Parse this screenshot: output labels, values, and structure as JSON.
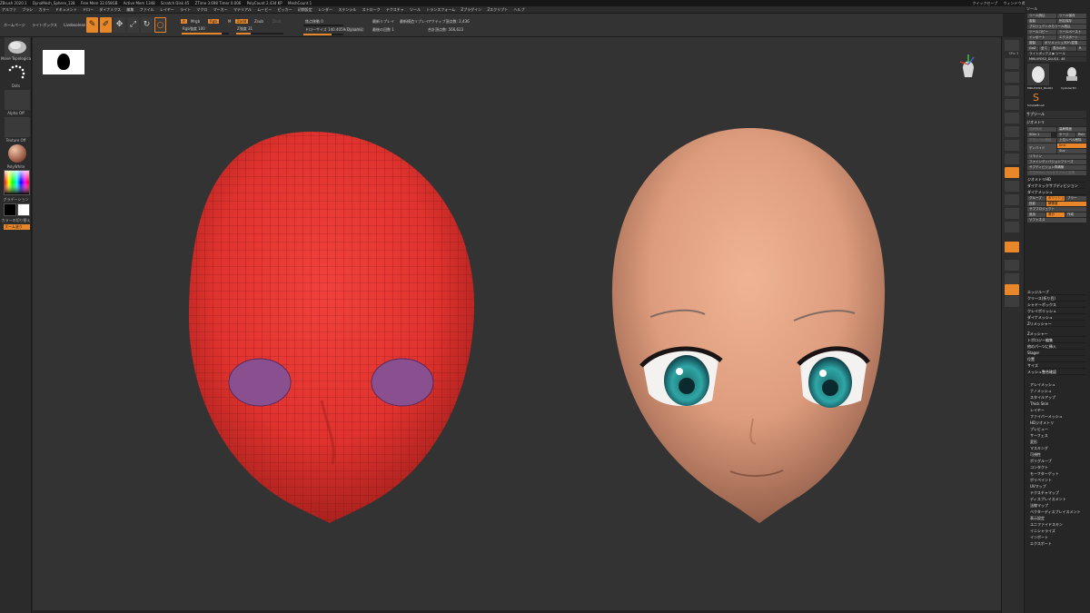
{
  "titlebar": {
    "title": "ZBrush 2020.1",
    "doc": "DynaMesh_Sphere_128",
    "stats": [
      "Free Mem 32.058GB",
      "Active Mem 1348",
      "Scratch Disk 45",
      "ZTime 3.698 Timer 0.006",
      "PolyCount 2.434 KP",
      "MeshCount 1"
    ],
    "right": [
      "クイックセーブ",
      "ウィンドウ透明度",
      "Menu",
      "DefaultZScript"
    ]
  },
  "menubar": {
    "items": [
      "アルファ",
      "ブラシ",
      "カラー",
      "ドキュメント",
      "ドロー",
      "ダイナミクス",
      "編集",
      "ファイル",
      "レイヤー",
      "ライト",
      "マクロ",
      "マーカー",
      "マテリアル",
      "ムービー",
      "ピッカー",
      "初期設定",
      "レンダー",
      "ステンシル",
      "ストローク",
      "テクスチャ",
      "ツール",
      "トランスフォーム",
      "Zプラグイン",
      "Zスクリプト",
      "ヘルプ"
    ]
  },
  "shelf": {
    "nav": [
      "ホームページ",
      "ライトボックス",
      "Liveboolean"
    ],
    "tool_buttons": [
      "編集",
      "ドロー",
      "移動",
      "拡大縮小",
      "回転"
    ],
    "mrgb": "Mrgb",
    "rgb": "Rgb",
    "m": "M",
    "zadd": "Zadd",
    "zsub": "Zsub",
    "zcut": "Zcut",
    "rgb_intensity": "Rgb強度 100",
    "z_intensity": "Z強度 31",
    "focal_shift": "焦点移動 0",
    "draw_size": "ドローサイズ 140.40594",
    "dynamic": "Dynamic",
    "active_points": "アクティブ頂点数: 2,436",
    "total_points": "合計頂点数: 566,623",
    "dynamesh": "最新リプレイ",
    "replay": "最新模造リプレイ",
    "divisions": "最後の回数 1",
    "rgb_fill": 0.85,
    "z_fill": 0.3,
    "draw_fill": 0.7
  },
  "left_tray": {
    "brush_label": "Move Topologica",
    "stroke_label": "Dots",
    "alpha_label": "Alpha Off",
    "texture_label": "Texture Off",
    "material_label": "PolyWhite",
    "gradient_label": "グラデーション",
    "swap_label": "カラーの切り替え",
    "fill_label": "ズーム塗り"
  },
  "right_tray": [
    "BPR",
    "SPix 3",
    "スクロール",
    "ズーム",
    "実際サイズ",
    "AAHalf",
    "ダイナミック",
    "パースペクティブ",
    "床",
    "ローカル",
    "XYZ",
    "フレーム",
    "移動",
    "拡大縮小",
    "回転",
    "ラインフィル",
    "PolyF",
    "透明",
    "ゴースト",
    "ソロ",
    "Xpose"
  ],
  "tool_panel": {
    "header": "ツール",
    "buttons": [
      "ツール読込",
      "ツール保存",
      "複製",
      "別名保存",
      "プロジェクトからツール読込",
      "ツールコピー",
      "ツールペースト",
      "インポート",
      "エクスポート",
      "複製",
      "ポリメッシュ3Dへ変換",
      "GoZ",
      "全て",
      "表示のみ",
      "R"
    ],
    "lightbox_label": "ライトボックス ▶ ツール",
    "current_tool": "MIKUIYOS3_DLUQ1. 48",
    "thumbs": [
      "MIKUIYOS3_DLUQ1",
      "Cylinder3D",
      "SimpleBrush"
    ],
    "subtool_header": "サブツール",
    "geometry_header": "ジオメトリ",
    "geometry_items": [
      "低解像度",
      "高解像度",
      "SDiv 1",
      "ケージ",
      "Rstr",
      "下位レベル削除",
      "上位レベル削除",
      "ディバイド",
      "Smt",
      "Suv",
      "リライン",
      "ファインディバジョンフリーズ",
      "サブディビジョン再構築",
      "下位SDivレベルをモデルに変換",
      "ジオメトリHD"
    ],
    "dynamesh_header": "ダイナミックサブディビジョン",
    "dynamesh_items": [
      "ダイナメッシュ",
      "グループ",
      "ポリッシュ",
      "ブラー",
      "投影",
      "解像度",
      "サブプロジェクト",
      "追加",
      "差分",
      "作成",
      "ソフトネス"
    ],
    "sections": [
      "エッジループ",
      "クリース(折り目)",
      "シャドーボックス",
      "クレイポリッシュ",
      "ダイナメッシュ",
      "Zリメッシャー",
      "Zメッシャー",
      "トポロジー編集",
      "他のパーツに挿入",
      "Stager",
      "位置",
      "サイズ",
      "メッシュ整合確認"
    ],
    "list": [
      "アレイメッシュ",
      "ナノメッシュ",
      "スタイルアップ",
      "Thick Skin",
      "レイヤー",
      "ファイバーメッシュ",
      "HDジオメトリ",
      "プレビュー",
      "サーフェス",
      "変形",
      "マスキング",
      "可視性",
      "ポリグループ",
      "コンタクト",
      "モーフターゲット",
      "ポリペイント",
      "UVマップ",
      "テクスチャマップ",
      "ディスプレイスメント",
      "法線マップ",
      "ベクターディスプレイスメント",
      "表示設定",
      "ユニファイドスキン",
      "イニシャライズ",
      "インポート",
      "エクスポート"
    ]
  }
}
